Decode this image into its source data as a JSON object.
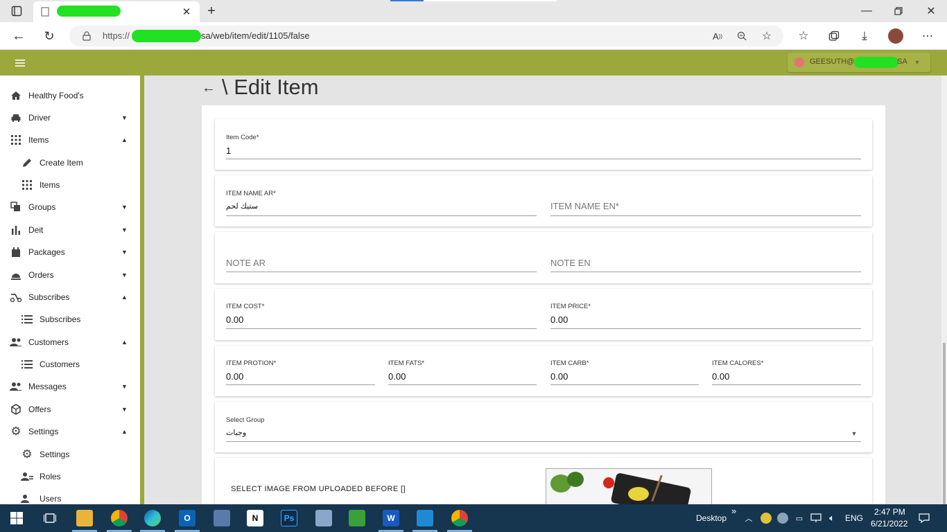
{
  "browser": {
    "tab_title": "",
    "url_prefix": "https://",
    "url_suffix": "sa/web/item/edit/1105/false"
  },
  "header": {
    "user_prefix": "GEESUTH@",
    "user_suffix": "SA"
  },
  "sidebar": {
    "items": [
      {
        "label": "Healthy Food's",
        "icon": "home-icon",
        "caret": ""
      },
      {
        "label": "Driver",
        "icon": "car-icon",
        "caret": "▼"
      },
      {
        "label": "Items",
        "icon": "grid-icon",
        "caret": "▲"
      },
      {
        "label": "Create Item",
        "icon": "pencil-icon",
        "caret": ""
      },
      {
        "label": "Items",
        "icon": "grid-icon",
        "caret": ""
      },
      {
        "label": "Groups",
        "icon": "layers-icon",
        "caret": "▼"
      },
      {
        "label": "Deit",
        "icon": "bar-chart-icon",
        "caret": "▼"
      },
      {
        "label": "Packages",
        "icon": "calendar-icon",
        "caret": "▼"
      },
      {
        "label": "Orders",
        "icon": "food-tray-icon",
        "caret": "▼"
      },
      {
        "label": "Subscribes",
        "icon": "scooter-icon",
        "caret": "▲"
      },
      {
        "label": "Subscribes",
        "icon": "list-icon",
        "caret": ""
      },
      {
        "label": "Customers",
        "icon": "people-icon",
        "caret": "▲"
      },
      {
        "label": "Customers",
        "icon": "list-icon",
        "caret": ""
      },
      {
        "label": "Messages",
        "icon": "people-icon",
        "caret": "▼"
      },
      {
        "label": "Offers",
        "icon": "box-icon",
        "caret": "▼"
      },
      {
        "label": "Settings",
        "icon": "gear-icon",
        "caret": "▲"
      },
      {
        "label": "Settings",
        "icon": "gear-icon",
        "caret": ""
      },
      {
        "label": "Roles",
        "icon": "user-role-icon",
        "caret": ""
      },
      {
        "label": "Users",
        "icon": "users-icon",
        "caret": ""
      }
    ]
  },
  "page": {
    "back_arrow": "←",
    "title": "\\ Edit Item"
  },
  "form": {
    "item_code_label": "Item Code*",
    "item_code_value": "1",
    "item_name_ar_label": "ITEM NAME AR*",
    "item_name_ar_value": "ستيك لحم",
    "item_name_en_placeholder": "ITEM NAME EN*",
    "note_ar_placeholder": "NOTE AR",
    "note_en_placeholder": "NOTE EN",
    "item_cost_label": "ITEM COST*",
    "item_cost_value": "0.00",
    "item_price_label": "ITEM PRICE*",
    "item_price_value": "0.00",
    "item_protion_label": "ITEM PROTION*",
    "item_protion_value": "0.00",
    "item_fats_label": "ITEM FATS*",
    "item_fats_value": "0.00",
    "item_carb_label": "ITEM CARB*",
    "item_carb_value": "0.00",
    "item_calores_label": "ITEM CALORES*",
    "item_calores_value": "0.00",
    "group_label": "Select Group",
    "group_value": "وجبات",
    "select_image_label": "SELECT IMAGE FROM UPLOADED BEFORE []"
  },
  "taskbar": {
    "desktop_label": "Desktop",
    "chevron": "»",
    "lang": "ENG",
    "time": "2:47 PM",
    "date": "6/21/2022"
  },
  "colors": {
    "brand": "#9aa83c",
    "taskbar": "#16354f"
  }
}
